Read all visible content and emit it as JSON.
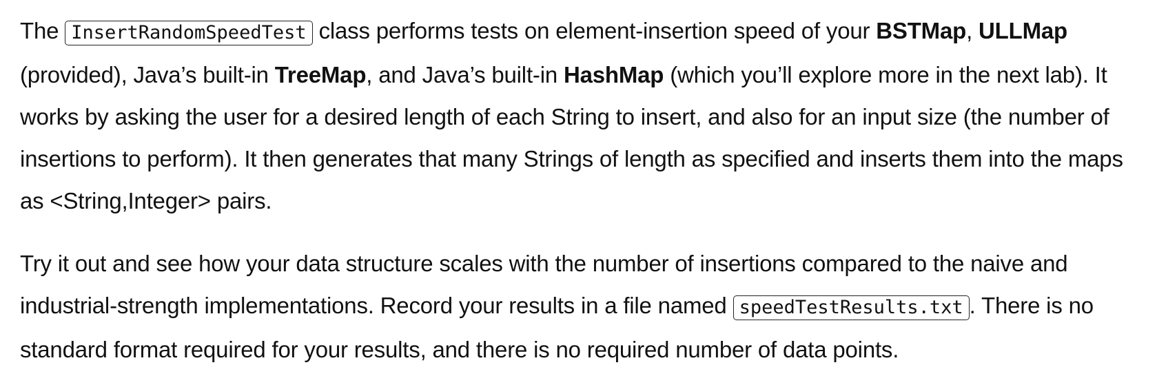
{
  "paragraph1": {
    "t1": "The ",
    "code1": "InsertRandomSpeedTest",
    "t2": " class performs tests on element-insertion speed of your ",
    "b1": "BSTMap",
    "t3": ", ",
    "b2": "ULLMap",
    "t4": " (provided), Java’s built-in ",
    "b3": "TreeMap",
    "t5": ", and Java’s built-in ",
    "b4": "HashMap",
    "t6": " (which you’ll explore more in the next lab). It works by asking the user for a desired length of each String to insert, and also for an input size (the number of insertions to perform). It then generates that many Strings of length as specified and inserts them into the maps as <String,Integer> pairs."
  },
  "paragraph2": {
    "t1": "Try it out and see how your data structure scales with the number of insertions compared to the naive and industrial-strength implementations. Record your results in a file named ",
    "code1": "speedTestResults.txt",
    "t2": ". There is no standard format required for your results, and there is no required number of data points."
  }
}
